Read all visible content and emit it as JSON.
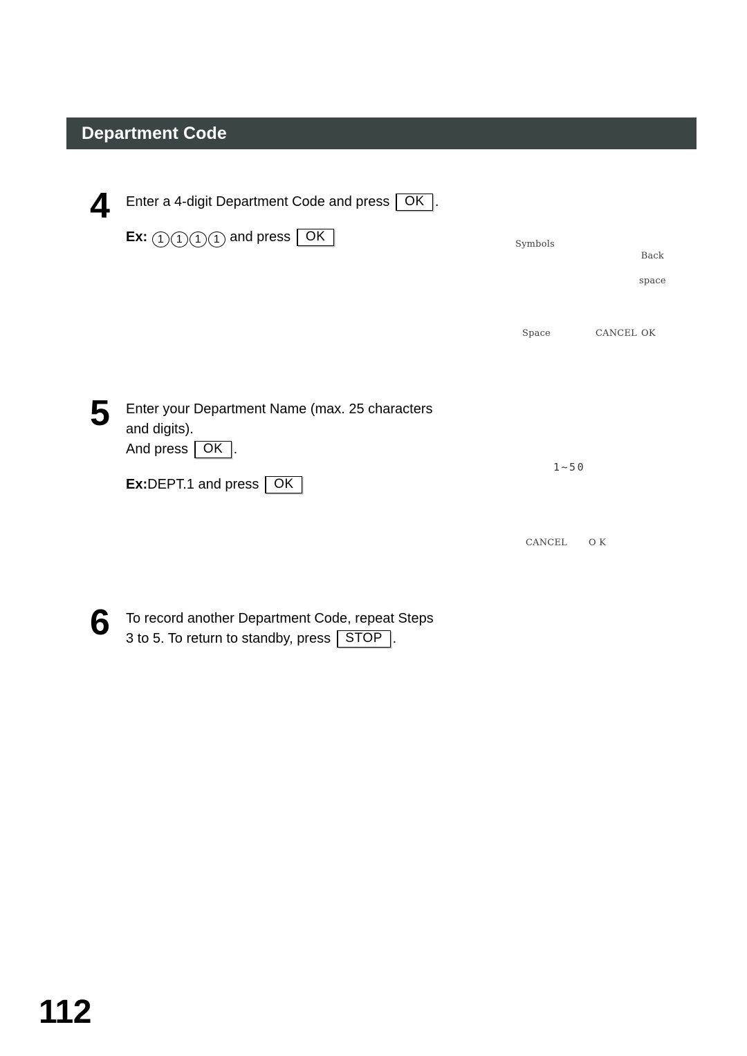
{
  "header": {
    "title": "Department Code",
    "bar_color": "#3b4546"
  },
  "steps": [
    {
      "number": "4",
      "line1_pre": "Enter a 4-digit Department Code and press",
      "line1_key": "OK",
      "line1_post": ".",
      "example_label": "Ex:",
      "example_keys": [
        "1",
        "1",
        "1",
        "1"
      ],
      "example_mid": "and press",
      "example_key": "OK"
    },
    {
      "number": "5",
      "line1": "Enter your Department Name (max. 25 characters",
      "line2": "and digits).",
      "line3_pre": "And press",
      "line3_key": "OK",
      "line3_post": ".",
      "example_label": "Ex:",
      "example_text": "DEPT.1 and press",
      "example_key": "OK"
    },
    {
      "number": "6",
      "line1": "To record another Department Code, repeat Steps",
      "line2_pre": "3 to 5. To return to standby, press",
      "line2_key": "STOP",
      "line2_post": "."
    }
  ],
  "lcd_panels": {
    "panel_step4": {
      "symbols": "Symbols",
      "backspace_line1": "Back",
      "backspace_line2": "space",
      "space": "Space",
      "cancel": "CANCEL",
      "ok": "OK"
    },
    "panel_step5": {
      "range": "1~50",
      "cancel": "CANCEL",
      "ok": "O K"
    }
  },
  "footer": {
    "page_number": "112"
  }
}
